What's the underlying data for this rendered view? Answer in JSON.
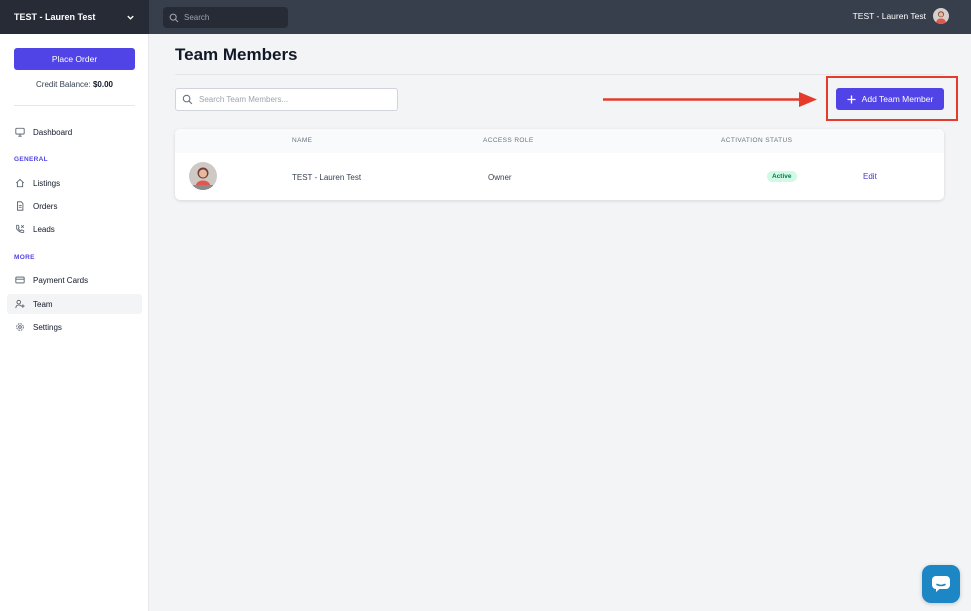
{
  "topbar": {
    "workspace_name": "TEST - Lauren Test",
    "search_placeholder": "Search",
    "user_name": "TEST - Lauren Test"
  },
  "sidebar": {
    "place_order_label": "Place Order",
    "credit_label": "Credit Balance:",
    "credit_value": "$0.00",
    "dashboard_label": "Dashboard",
    "general_label": "GENERAL",
    "general_items": [
      {
        "label": "Listings",
        "icon": "home-icon"
      },
      {
        "label": "Orders",
        "icon": "document-icon"
      },
      {
        "label": "Leads",
        "icon": "phone-icon"
      }
    ],
    "more_label": "MORE",
    "more_items": [
      {
        "label": "Payment Cards",
        "icon": "credit-card-icon"
      },
      {
        "label": "Team",
        "icon": "user-plus-icon",
        "active": true
      },
      {
        "label": "Settings",
        "icon": "gear-icon"
      }
    ]
  },
  "main": {
    "title": "Team Members",
    "search_placeholder": "Search Team Members...",
    "add_button_label": "Add Team Member",
    "table": {
      "headers": [
        "NAME",
        "ACCESS ROLE",
        "ACTIVATION STATUS"
      ],
      "rows": [
        {
          "name": "TEST - Lauren Test",
          "role": "Owner",
          "status": "Active",
          "action": "Edit"
        }
      ]
    }
  },
  "colors": {
    "primary": "#5144e6",
    "topbar": "#373e4c",
    "annotation_red": "#e53b2b",
    "active_badge_bg": "#d1fae5",
    "active_badge_text": "#047857",
    "chat_button": "#1d87c5"
  }
}
